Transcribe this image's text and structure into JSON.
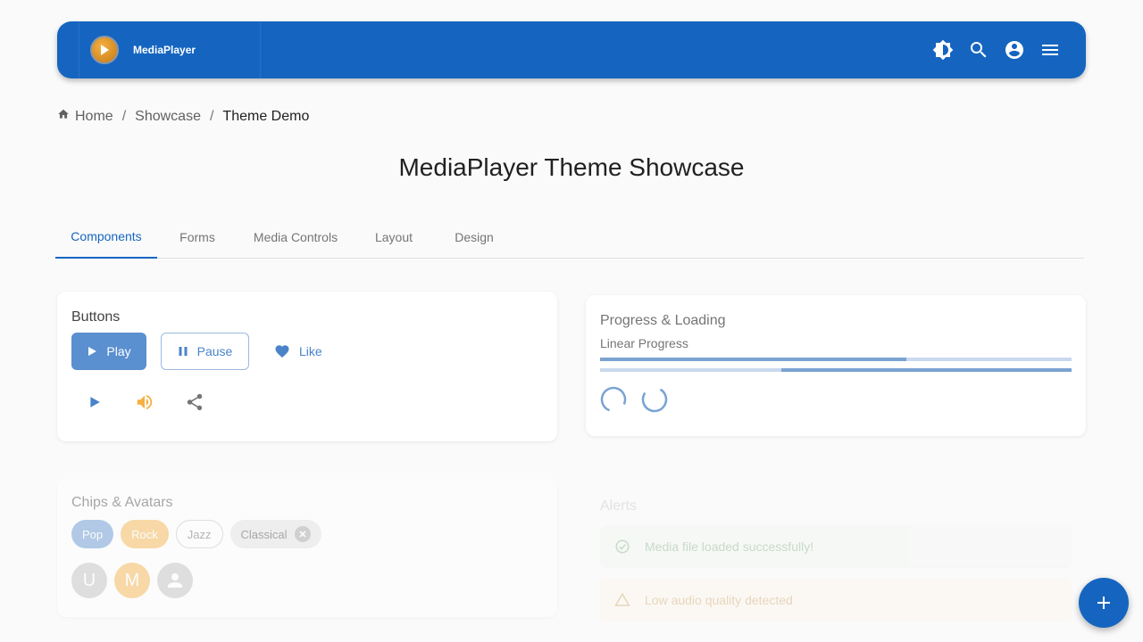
{
  "appbar": {
    "brand": "MediaPlayer",
    "icons": [
      "brightness-icon",
      "search-icon",
      "account-icon",
      "menu-icon"
    ]
  },
  "breadcrumb": {
    "items": [
      "Home",
      "Showcase",
      "Theme Demo"
    ],
    "separator": "/"
  },
  "page": {
    "title": "MediaPlayer Theme Showcase"
  },
  "tabs": [
    "Components",
    "Forms",
    "Media Controls",
    "Layout",
    "Design"
  ],
  "active_tab": "Components",
  "buttons_card": {
    "title": "Buttons",
    "play": "Play",
    "pause": "Pause",
    "like": "Like",
    "icon_buttons": [
      "play-icon",
      "volume-icon",
      "share-icon"
    ]
  },
  "progress_card": {
    "title": "Progress & Loading",
    "subtitle": "Linear Progress",
    "determinate_value": 0.65,
    "buffer_segment": [
      0.385,
      1.0
    ]
  },
  "chips_card": {
    "title": "Chips & Avatars",
    "chips": [
      "Pop",
      "Rock",
      "Jazz",
      "Classical"
    ],
    "avatars": [
      "U",
      "M"
    ]
  },
  "alerts_card": {
    "title": "Alerts",
    "alerts": [
      "Media file loaded successfully!",
      "Low audio quality detected"
    ]
  },
  "colors": {
    "primary": "#1565c0",
    "secondary": "#f5b041",
    "primary_light": "#5a8fd0"
  }
}
